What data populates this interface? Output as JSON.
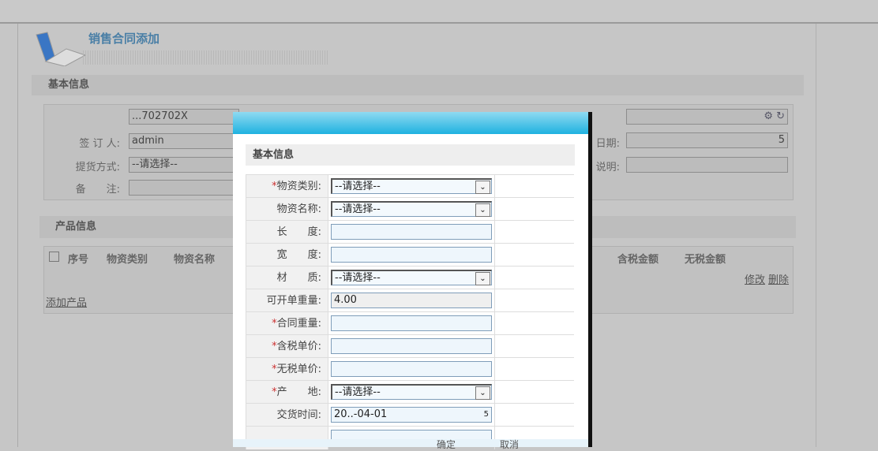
{
  "page": {
    "title": "销售合同添加",
    "basic_section": "基本信息",
    "product_section": "产品信息",
    "fields": {
      "contract_no_value": "...702702X",
      "signer_label": "签 订 人:",
      "signer_value": "admin",
      "delivery_label": "提货方式:",
      "delivery_value": "--请选择--",
      "remark_label": "备　　注:",
      "date_label": "日期:",
      "desc_label": "说明:",
      "date_icon": "5"
    },
    "table": {
      "headers": [
        "序号",
        "物资类别",
        "物资名称",
        "含税金额",
        "无税金额"
      ],
      "edit": "修改",
      "delete": "删除",
      "add_product": "添加产品"
    }
  },
  "modal": {
    "section": "基本信息",
    "rows": [
      {
        "label": "物资类别:",
        "required": true,
        "value": "--请选择--",
        "type": "select"
      },
      {
        "label": "物资名称:",
        "required": false,
        "value": "--请选择--",
        "type": "select"
      },
      {
        "label": "长　　度:",
        "required": false,
        "value": "",
        "type": "text"
      },
      {
        "label": "宽　　度:",
        "required": false,
        "value": "",
        "type": "text"
      },
      {
        "label": "材　　质:",
        "required": false,
        "value": "--请选择--",
        "type": "select"
      },
      {
        "label": "可开单重量:",
        "required": false,
        "value": "4.00",
        "type": "readonly"
      },
      {
        "label": "合同重量:",
        "required": true,
        "value": "",
        "type": "text"
      },
      {
        "label": "含税单价:",
        "required": true,
        "value": "",
        "type": "text"
      },
      {
        "label": "无税单价:",
        "required": true,
        "value": "",
        "type": "text"
      },
      {
        "label": "产　　地:",
        "required": true,
        "value": "--请选择--",
        "type": "select"
      },
      {
        "label": "交货时间:",
        "required": false,
        "value": "20..-04-01",
        "type": "date"
      },
      {
        "label": "",
        "required": false,
        "value": "",
        "type": "textarea"
      }
    ],
    "confirm": "确定",
    "cancel": "取消"
  }
}
